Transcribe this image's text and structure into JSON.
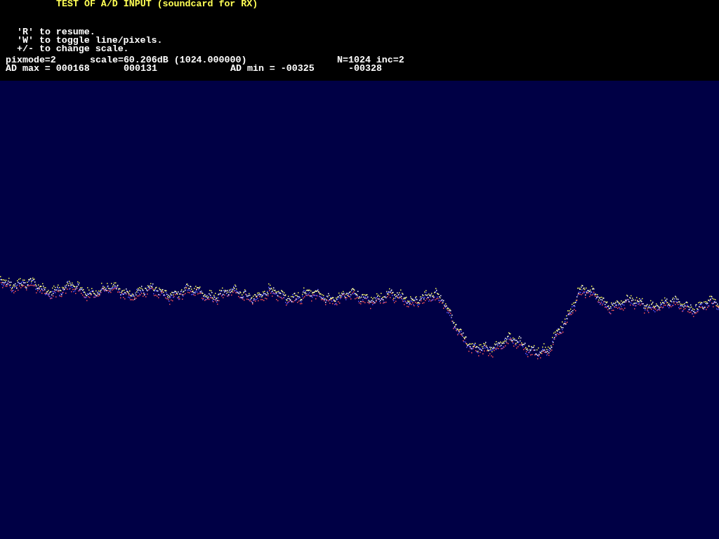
{
  "title": "TEST OF A/D INPUT (soundcard for RX)",
  "help_lines": [
    "'R' to resume.",
    "'W' to toggle line/pixels.",
    "+/- to change scale."
  ],
  "status_line_1": [
    "pixmode=2",
    "scale=60.206dB (1024.000000)",
    "N=1024 inc=2"
  ],
  "status_line_2": [
    "AD max = 000168",
    "000131",
    "AD min = -00325",
    "-00328"
  ]
}
